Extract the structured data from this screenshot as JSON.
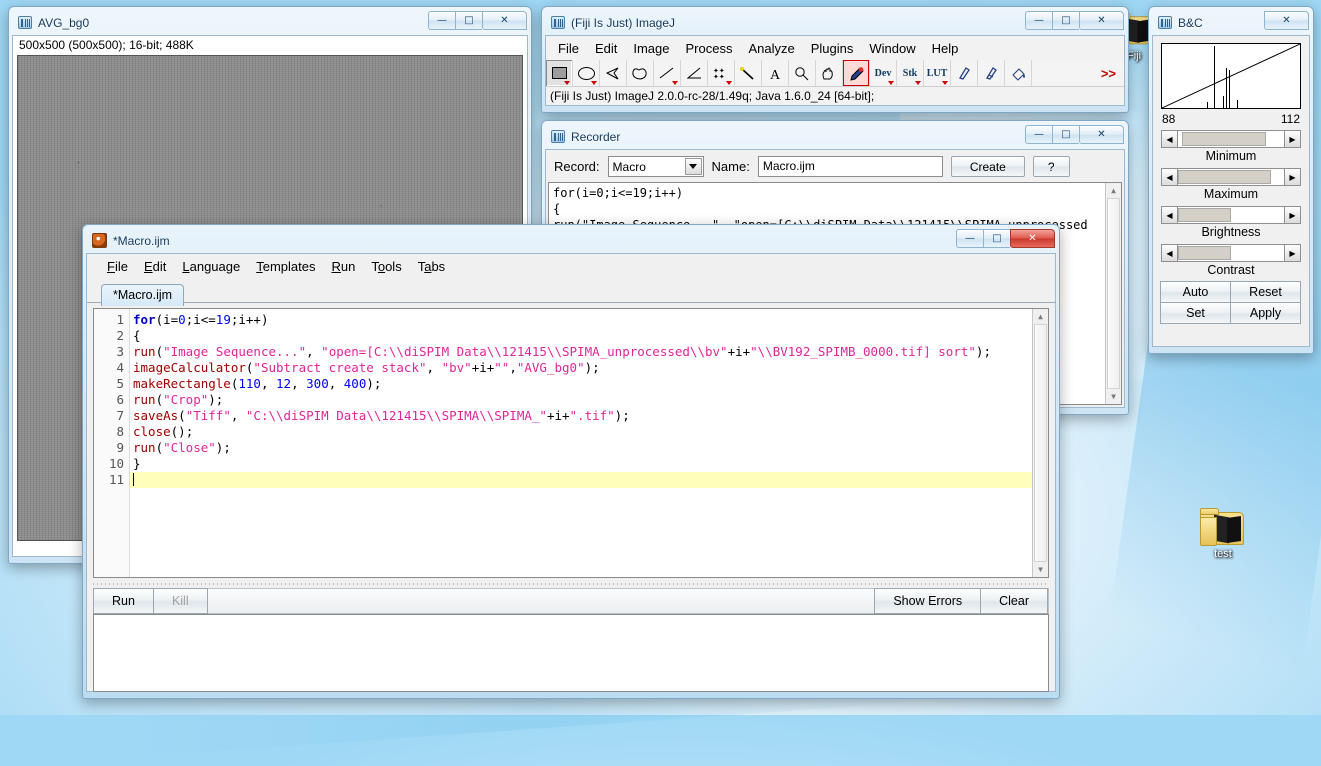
{
  "desktop": {
    "icons": [
      {
        "name": "test",
        "label": "test",
        "type": "folder"
      },
      {
        "name": "fiji",
        "label": "Fiji",
        "type": "folder"
      }
    ]
  },
  "avg_window": {
    "title": "AVG_bg0",
    "info": "500x500  (500x500); 16-bit; 488K",
    "buttons": {
      "minimize": "–",
      "maximize": "□",
      "close": "✕"
    }
  },
  "imagej": {
    "title": "(Fiji Is Just) ImageJ",
    "menus": [
      {
        "label": "File",
        "mnemonic": "F"
      },
      {
        "label": "Edit",
        "mnemonic": "E"
      },
      {
        "label": "Image",
        "mnemonic": "I"
      },
      {
        "label": "Process",
        "mnemonic": "P"
      },
      {
        "label": "Analyze",
        "mnemonic": "A"
      },
      {
        "label": "Plugins",
        "mnemonic": "P"
      },
      {
        "label": "Window",
        "mnemonic": "W"
      },
      {
        "label": "Help",
        "mnemonic": "H"
      }
    ],
    "tools": [
      {
        "icon": "rectangle-tool-icon",
        "label": "",
        "selected": true,
        "dropdown": true
      },
      {
        "icon": "oval-tool-icon",
        "label": "",
        "selected": false,
        "dropdown": true
      },
      {
        "icon": "polygon-tool-icon",
        "label": "",
        "selected": false,
        "dropdown": false
      },
      {
        "icon": "freehand-tool-icon",
        "label": "",
        "selected": false,
        "dropdown": false
      },
      {
        "icon": "line-tool-icon",
        "label": "",
        "selected": false,
        "dropdown": true
      },
      {
        "icon": "angle-tool-icon",
        "label": "",
        "selected": false,
        "dropdown": false
      },
      {
        "icon": "point-tool-icon",
        "label": "",
        "selected": false,
        "dropdown": true
      },
      {
        "icon": "wand-tool-icon",
        "label": "",
        "selected": false,
        "dropdown": false
      },
      {
        "icon": "text-tool-icon",
        "label": "",
        "selected": false,
        "dropdown": false
      },
      {
        "icon": "magnifier-tool-icon",
        "label": "",
        "selected": false,
        "dropdown": false
      },
      {
        "icon": "hand-tool-icon",
        "label": "",
        "selected": false,
        "dropdown": false
      },
      {
        "icon": "dropper-tool-icon",
        "label": "",
        "selected": false,
        "dropdown": false,
        "highlight": true
      },
      {
        "icon": "dev-tool-icon",
        "label": "Dev",
        "selected": false,
        "dropdown": true
      },
      {
        "icon": "stk-tool-icon",
        "label": "Stk",
        "selected": false,
        "dropdown": true
      },
      {
        "icon": "lut-tool-icon",
        "label": "LUT",
        "selected": false,
        "dropdown": true
      },
      {
        "icon": "pencil-tool-icon",
        "label": "",
        "selected": false,
        "dropdown": false
      },
      {
        "icon": "brush-tool-icon",
        "label": "",
        "selected": false,
        "dropdown": false
      },
      {
        "icon": "flood-fill-tool-icon",
        "label": "",
        "selected": false,
        "dropdown": false
      }
    ],
    "more_label": ">>",
    "status": "(Fiji Is Just) ImageJ 2.0.0-rc-28/1.49q; Java 1.6.0_24 [64-bit];"
  },
  "recorder": {
    "title": "Recorder",
    "record_label": "Record:",
    "record_value": "Macro",
    "name_label": "Name:",
    "name_value": "Macro.ijm",
    "create_label": "Create",
    "help_label": "?",
    "lines": [
      "for(i=0;i<=19;i++)",
      "{",
      "run(\"Image Sequence...\", \"open=[C:\\\\diSPIM Data\\\\121415\\\\SPIMA_unprocessed"
    ]
  },
  "bc": {
    "title": "B&C",
    "hist_min": "88",
    "hist_max": "112",
    "sliders": [
      {
        "caption": "Minimum",
        "fill_left_pct": 4,
        "fill_width_pct": 79
      },
      {
        "caption": "Maximum",
        "fill_left_pct": 0,
        "fill_width_pct": 88
      },
      {
        "caption": "Brightness",
        "fill_left_pct": 0,
        "fill_width_pct": 50
      },
      {
        "caption": "Contrast",
        "fill_left_pct": 0,
        "fill_width_pct": 50
      }
    ],
    "buttons": [
      "Auto",
      "Reset",
      "Set",
      "Apply"
    ]
  },
  "macro_editor": {
    "title": "*Macro.ijm",
    "menus": [
      {
        "label": "File",
        "mnemonic": "F"
      },
      {
        "label": "Edit",
        "mnemonic": "E"
      },
      {
        "label": "Language",
        "mnemonic": "L"
      },
      {
        "label": "Templates",
        "mnemonic": "T"
      },
      {
        "label": "Run",
        "mnemonic": "R"
      },
      {
        "label": "Tools",
        "mnemonic": "o"
      },
      {
        "label": "Tabs",
        "mnemonic": "a"
      }
    ],
    "tab_label": "*Macro.ijm",
    "line_numbers": [
      "1",
      "2",
      "3",
      "4",
      "5",
      "6",
      "7",
      "8",
      "9",
      "10",
      "11"
    ],
    "code": [
      "for(i=0;i<=19;i++)",
      "{",
      "run(\"Image Sequence...\", \"open=[C:\\\\diSPIM Data\\\\121415\\\\SPIMA_unprocessed\\\\bv\"+i+\"\\\\BV192_SPIMB_0000.tif] sort\");",
      "imageCalculator(\"Subtract create stack\", \"bv\"+i+\"\",\"AVG_bg0\");",
      "makeRectangle(110, 12, 300, 400);",
      "run(\"Crop\");",
      "saveAs(\"Tiff\", \"C:\\\\diSPIM Data\\\\121415\\\\SPIMA\\\\SPIMA_\"+i+\".tif\");",
      "close();",
      "run(\"Close\");",
      "}",
      ""
    ],
    "current_line": 11,
    "run_label": "Run",
    "kill_label": "Kill",
    "show_errors_label": "Show Errors",
    "clear_label": "Clear",
    "output_text": ""
  },
  "colors": {
    "accent": "#2d6490",
    "title_text": "#15385c",
    "close_red": "#c9392c",
    "code_keyword": "#0000c0",
    "code_function": "#a00000",
    "code_string": "#e0259a",
    "current_line": "#ffffbb",
    "desktop": "#9fd8f5"
  }
}
